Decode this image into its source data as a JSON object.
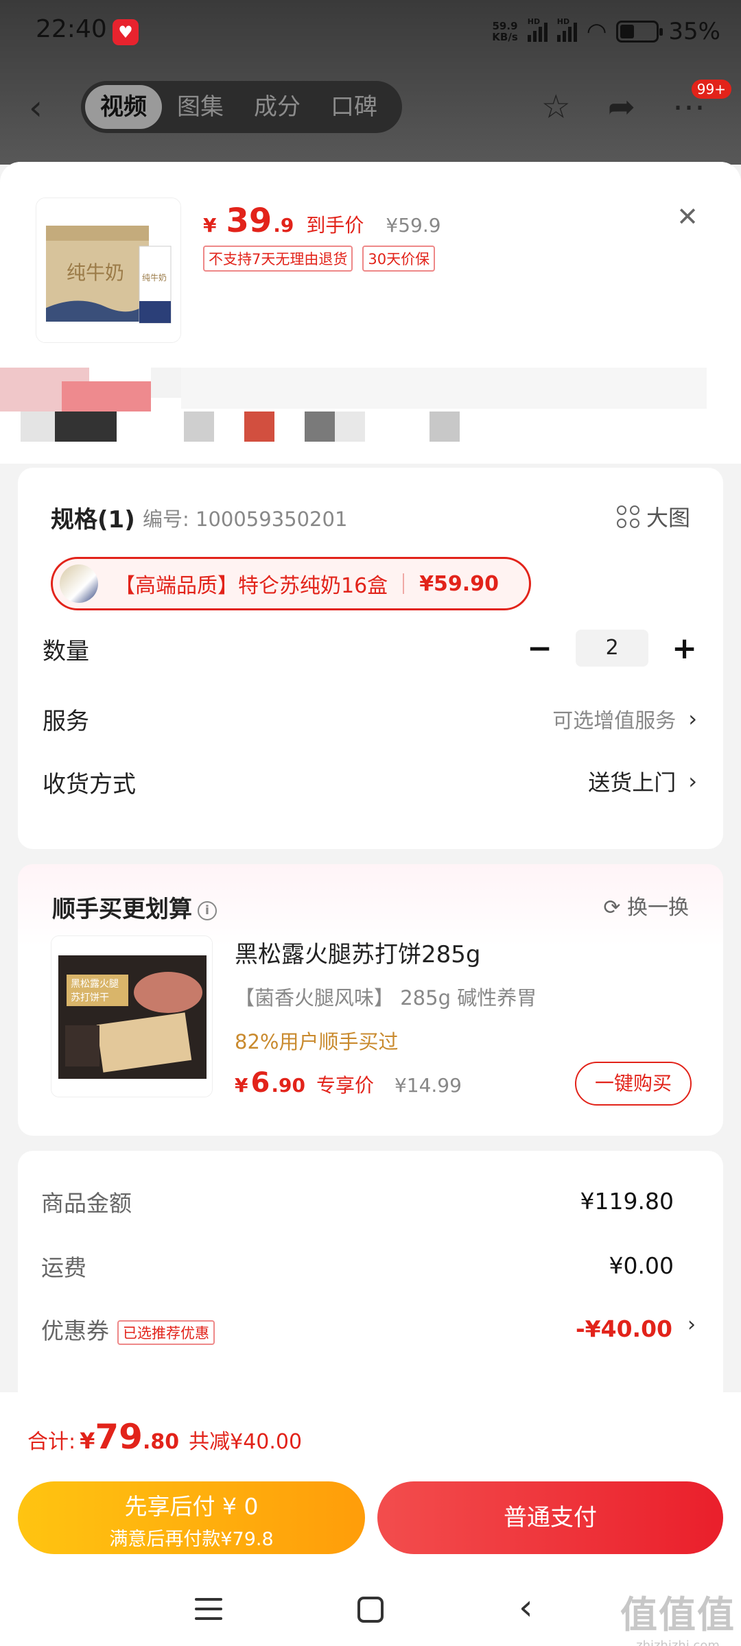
{
  "status_bar": {
    "time": "22:40",
    "net_speed": "59.9\nKB/s",
    "hd1": "HD",
    "hd2": "HD",
    "battery": "35%"
  },
  "nav": {
    "tabs": [
      "视频",
      "图集",
      "成分",
      "口碑"
    ],
    "badge": "99+"
  },
  "product": {
    "price_yen": "¥",
    "price_int": "39",
    "price_dec": ".9",
    "price_label": "到手价",
    "orig_price": "¥59.9",
    "tags": [
      "不支持7天无理由退货",
      "30天价保"
    ]
  },
  "spec": {
    "title": "规格(1)",
    "number": "编号: 100059350201",
    "big_image": "大图",
    "chip_text": "【高端品质】特仑苏纯奶16盒",
    "chip_price": "¥59.90"
  },
  "rows": {
    "qty_label": "数量",
    "qty_value": "2",
    "qty_minus": "−",
    "qty_plus": "+",
    "service_label": "服务",
    "service_value": "可选增值服务",
    "delivery_label": "收货方式",
    "delivery_value": "送货上门"
  },
  "addon": {
    "title": "顺手买更划算",
    "swap": "换一换",
    "name": "黑松露火腿苏打饼285g",
    "sub": "【菌香火腿风味】 285g 碱性养胃",
    "rate": "82%用户顺手买过",
    "price_yen": "¥",
    "price_int": "6",
    "price_dec": ".90",
    "price_label": "专享价",
    "orig_price": "¥14.99",
    "buy_button": "一键购买"
  },
  "summary": {
    "goods_label": "商品金额",
    "goods_value": "¥119.80",
    "shipping_label": "运费",
    "shipping_value": "¥0.00",
    "coupon_label": "优惠券",
    "coupon_tag": "已选推荐优惠",
    "coupon_value": "-¥40.00"
  },
  "bottom": {
    "total_label": "合计:",
    "total_yen": "¥",
    "total_int": "79",
    "total_dec": ".80",
    "total_save": "共减¥40.00",
    "later_title": "先享后付 ¥ 0",
    "later_sub": "满意后再付款¥79.8",
    "pay_button": "普通支付"
  },
  "watermark": {
    "line1": "值值值",
    "line2": "zhizhizhi.com"
  },
  "colors": {
    "accent": "#e2231a",
    "later_btn": "#ffb30f",
    "gold_text": "#c98a2e"
  }
}
